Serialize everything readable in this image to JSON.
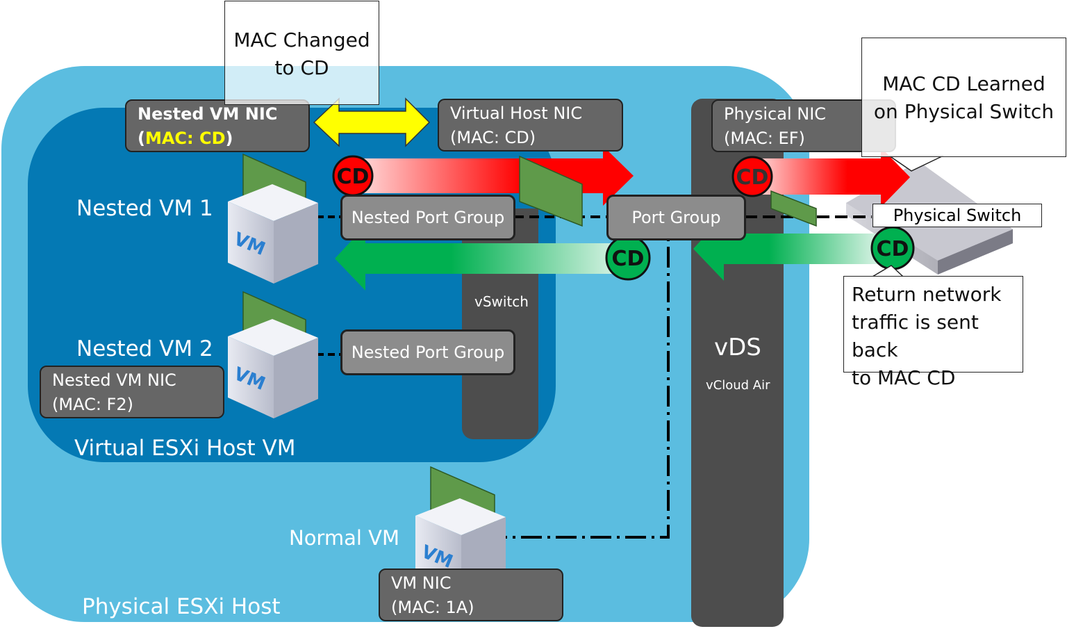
{
  "regions": {
    "physical_host": "Physical ESXi Host",
    "virtual_host": "Virtual ESXi Host VM",
    "vswitch": "vSwitch",
    "vds": "vDS",
    "vds_sub": "vCloud Air"
  },
  "vms": {
    "nested_vm1": "Nested VM 1",
    "nested_vm2": "Nested VM 2",
    "normal_vm": "Normal VM",
    "vm_logo_text": "VM"
  },
  "nics": {
    "nested_vm1_nic": {
      "line1": "Nested VM NIC",
      "open": "(",
      "mac": "MAC: CD",
      "close": ")"
    },
    "nested_vm2_nic": {
      "line1": "Nested VM NIC",
      "line2": "(MAC: F2)"
    },
    "virtual_host_nic": {
      "line1": "Virtual Host NIC",
      "line2": "(MAC: CD)"
    },
    "physical_nic": {
      "line1": "Physical NIC",
      "line2": "(MAC: EF)"
    },
    "normal_vm_nic": {
      "line1": "VM NIC",
      "line2": "(MAC: 1A)"
    }
  },
  "port_groups": {
    "nested_pg1": "Nested Port Group",
    "nested_pg2": "Nested Port Group",
    "port_group": "Port Group"
  },
  "switch_label": "Physical Switch",
  "callouts": {
    "mac_changed": {
      "line1": "MAC Changed",
      "line2": "to CD"
    },
    "mac_learned": {
      "line1": "MAC CD Learned",
      "line2": "on Physical Switch"
    },
    "return_traffic": {
      "line1": "Return network",
      "line2": "traffic is sent back",
      "line3": "to MAC CD"
    }
  },
  "badges": {
    "outbound1": "CD",
    "outbound2": "CD",
    "return1": "CD",
    "return2": "CD"
  },
  "colors": {
    "physical_host": "#5bbde0",
    "virtual_host": "#0479b4",
    "switch_bar": "#4d4d4d",
    "outbound_arrow": "#ff0000",
    "return_arrow": "#00b050",
    "mac_change_arrow": "#ffff00",
    "mac_highlight": "#ffff00"
  }
}
